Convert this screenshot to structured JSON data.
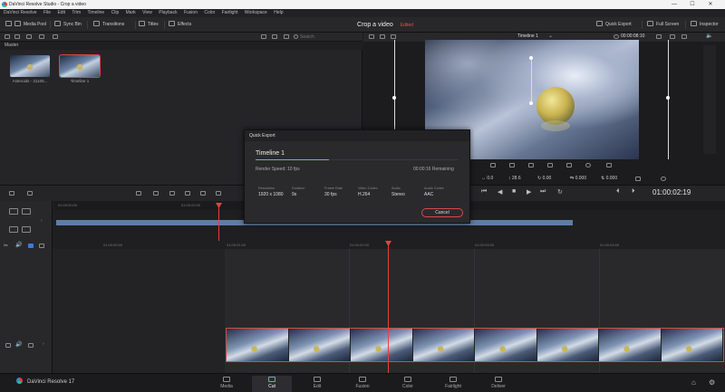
{
  "window": {
    "title": "DaVinci Resolve Studio - Crop a video",
    "controls": {
      "minimize": "—",
      "maximize": "☐",
      "close": "✕"
    }
  },
  "menu": [
    "DaVinci Resolve",
    "File",
    "Edit",
    "Trim",
    "Timeline",
    "Clip",
    "Mark",
    "View",
    "Playback",
    "Fusion",
    "Color",
    "Fairlight",
    "Workspace",
    "Help"
  ],
  "project": {
    "name": "Crop a video",
    "status": "Edited"
  },
  "toolbar": {
    "media_pool": "Media Pool",
    "sync_bin": "Sync Bin",
    "transitions": "Transitions",
    "titles": "Titles",
    "effects": "Effects",
    "quick_export": "Quick Export",
    "full_screen": "Full Screen",
    "inspector": "Inspector"
  },
  "media_pool": {
    "search_placeholder": "Search",
    "bin": "Master",
    "items": [
      {
        "label": "Asteroids - 31105..."
      },
      {
        "label": "Timeline 1"
      }
    ]
  },
  "viewer": {
    "timeline_name": "Timeline 1",
    "timecode": "00:00:08:10",
    "transform_values": {
      "x": "0.0",
      "y": "28.6",
      "rotation": "0.00",
      "flip_h": "0.000",
      "flip_v": "0.000"
    },
    "playback_timecode": "01:00:02:19"
  },
  "upper_ruler": [
    "01:00:00:00",
    "01:00:02:00"
  ],
  "lower_ruler": [
    "01:00:00:00",
    "01:00:01:00",
    "01:00:02:00",
    "01:00:03:00",
    "01:00:04:00"
  ],
  "quick_export": {
    "header": "Quick Export",
    "title": "Timeline 1",
    "progress": 0.36,
    "speed": "Render Speed: 10 fps",
    "remaining": "00:00:16 Remaining",
    "columns": [
      {
        "key": "Resolution",
        "value": "1920 x 1080"
      },
      {
        "key": "Duration",
        "value": "9s"
      },
      {
        "key": "Frame Rate",
        "value": "30 fps"
      },
      {
        "key": "Video Codec",
        "value": "H.264"
      },
      {
        "key": "Audio",
        "value": "Stereo"
      },
      {
        "key": "Audio Codec",
        "value": "AAC"
      }
    ],
    "cancel": "Cancel"
  },
  "pages": [
    "Media",
    "Cut",
    "Edit",
    "Fusion",
    "Color",
    "Fairlight",
    "Deliver"
  ],
  "active_page": "Cut",
  "brand": "DaVinci Resolve 17",
  "colors": {
    "accent": "#e84040",
    "clip": "#5e7da3",
    "progress": "#7fb866"
  }
}
